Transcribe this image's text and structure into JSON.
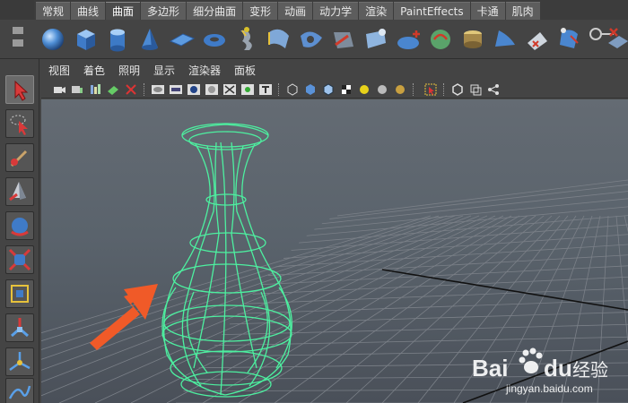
{
  "shelf_tabs": {
    "active": "曲面",
    "items": [
      "常规",
      "曲线",
      "曲面",
      "多边形",
      "细分曲面",
      "变形",
      "动画",
      "动力学",
      "渲染",
      "PaintEffects",
      "卡通",
      "肌肉"
    ]
  },
  "shelf_icons": [
    "nurbs-sphere-icon",
    "nurbs-cube-icon",
    "nurbs-cylinder-icon",
    "nurbs-cone-icon",
    "nurbs-plane-icon",
    "nurbs-torus-icon",
    "revolve-icon",
    "loft-icon",
    "planar-icon",
    "extrude-icon",
    "birail-icon",
    "boundary-icon",
    "square-surface-icon",
    "bevel-icon",
    "intersect-icon",
    "project-curve-icon",
    "trim-tool-icon",
    "untrim-icon",
    "attach-surfaces-icon",
    "detach-icon",
    "align-icon",
    "open-close-icon",
    "insert-isoparm-icon",
    "extend-icon",
    "offset-icon",
    "rebuild-icon"
  ],
  "toolbox": [
    "select-tool-icon",
    "lasso-tool-icon",
    "paint-select-icon",
    "move-tool-icon",
    "rotate-tool-icon",
    "scale-tool-icon",
    "universal-manipulator-icon",
    "soft-mod-icon",
    "show-manipulator-icon",
    "curve-tool-icon"
  ],
  "panel_menu": [
    "视图",
    "着色",
    "照明",
    "显示",
    "渲染器",
    "面板"
  ],
  "panel_toolbar_icons": [
    "camera-select-icon",
    "camera-attributes-icon",
    "bookmarks-icon",
    "image-plane-icon",
    "two-d-pan-zoom-icon",
    "grid-toggle-icon",
    "film-gate-icon",
    "resolution-gate-icon",
    "gate-mask-icon",
    "field-chart-icon",
    "safe-action-icon",
    "safe-title-icon",
    "wireframe-icon",
    "smooth-shade-icon",
    "wireframe-on-shaded-icon",
    "textured-icon",
    "use-all-lights-icon",
    "shadows-icon",
    "ambient-occlusion-icon",
    "isolate-select-icon",
    "xray-icon",
    "xray-joints-icon",
    "xray-components-icon"
  ],
  "viewport": {
    "object": "nurbs-vase-wireframe",
    "wire_color": "#4df0a0",
    "annotation": "orange-arrow"
  },
  "watermark": {
    "brand": "Bai",
    "brand_suffix": "du",
    "product": "经验",
    "url": "jingyan.baidu.com"
  },
  "colors": {
    "ui_bg": "#444444",
    "active_tab": "#4b4b4b",
    "wire": "#4df0a0",
    "arrow": "#f05a28"
  }
}
